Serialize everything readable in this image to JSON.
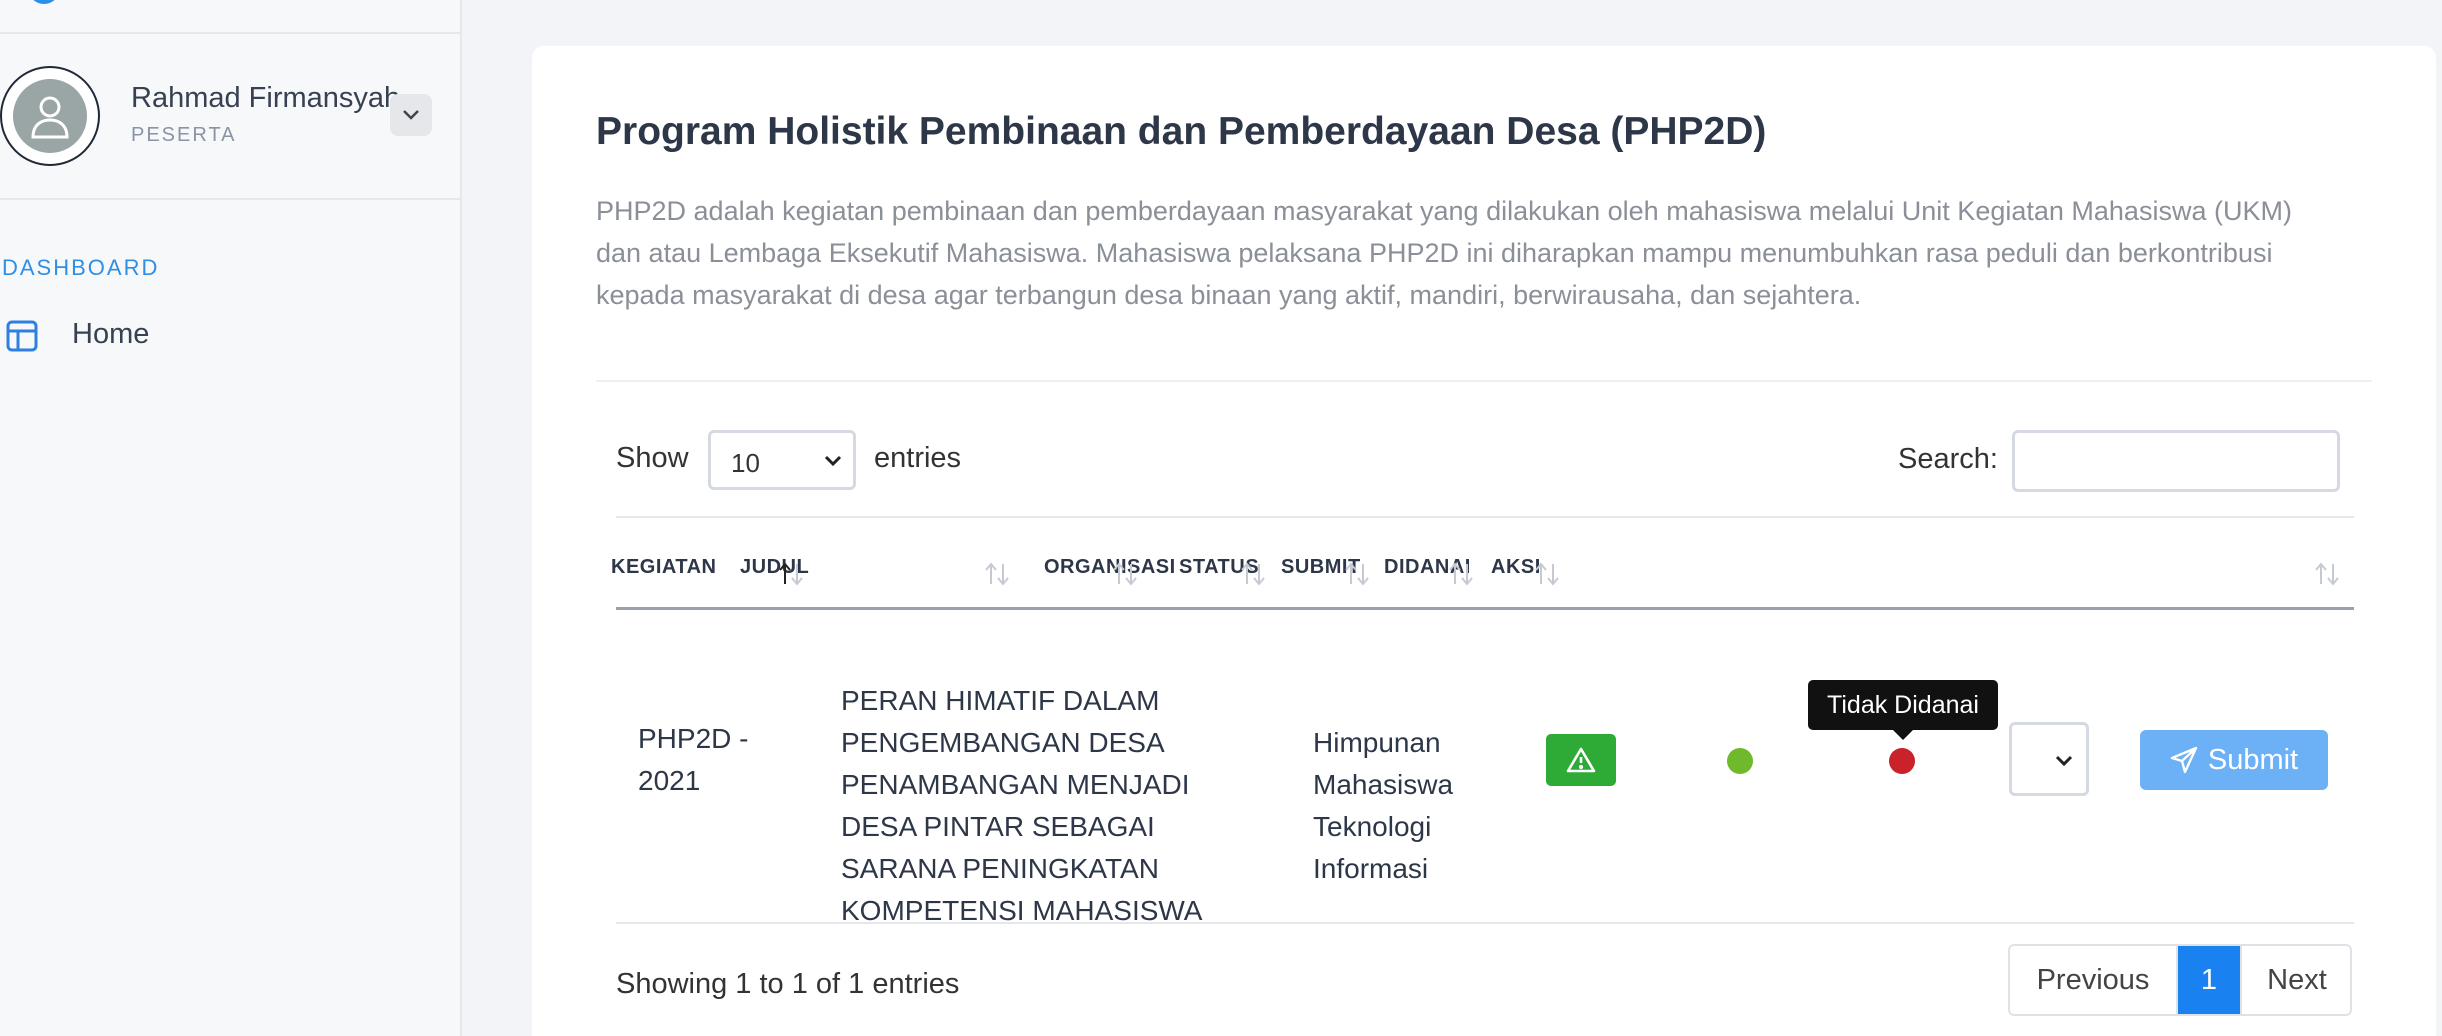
{
  "sidebar": {
    "user": {
      "name": "Rahmad Firmansyah",
      "role": "PESERTA"
    },
    "section_label": "DASHBOARD",
    "items": [
      {
        "label": "Home",
        "icon": "layout-icon"
      }
    ]
  },
  "main": {
    "title": "Program Holistik Pembinaan dan Pemberdayaan Desa (PHP2D)",
    "description": "PHP2D adalah kegiatan pembinaan dan pemberdayaan masyarakat yang dilakukan oleh mahasiswa melalui Unit Kegiatan Mahasiswa (UKM) dan atau Lembaga Eksekutif Mahasiswa. Mahasiswa pelaksana PHP2D ini diharapkan mampu menumbuhkan rasa peduli dan berkontribusi kepada masyarakat di desa agar terbangun desa binaan yang aktif, mandiri, berwirausaha, dan sejahtera."
  },
  "table_controls": {
    "show_label": "Show",
    "page_length": "10",
    "entries_label": "entries",
    "search_label": "Search:",
    "search_value": ""
  },
  "table": {
    "columns": [
      "KEGIATAN",
      "JUDUL",
      "ORGANISASI",
      "STATUS",
      "SUBMIT",
      "DIDANAI",
      "AKSI"
    ],
    "rows": [
      {
        "kegiatan": "PHP2D - 2021",
        "judul": "PERAN HIMATIF DALAM PENGEMBANGAN DESA PENAMBANGAN MENJADI DESA PINTAR SEBAGAI SARANA PENINGKATAN KOMPETENSI MAHASISWA",
        "organisasi": "Himpunan Mahasiswa Teknologi Informasi",
        "status_icon": "warning-icon",
        "submit_color": "#6fba2c",
        "didanai_color": "#c9222b",
        "didanai_tooltip": "Tidak Didanai",
        "aksi_value": "",
        "submit_label": "Submit"
      }
    ]
  },
  "footer": {
    "info": "Showing 1 to 1 of 1 entries",
    "pagination": {
      "previous": "Previous",
      "current": "1",
      "next": "Next"
    }
  },
  "colors": {
    "accent": "#1a82f0",
    "section": "#2f8fe6",
    "status_warning": "#2eaa37",
    "submit_button": "#6cb1f5"
  }
}
